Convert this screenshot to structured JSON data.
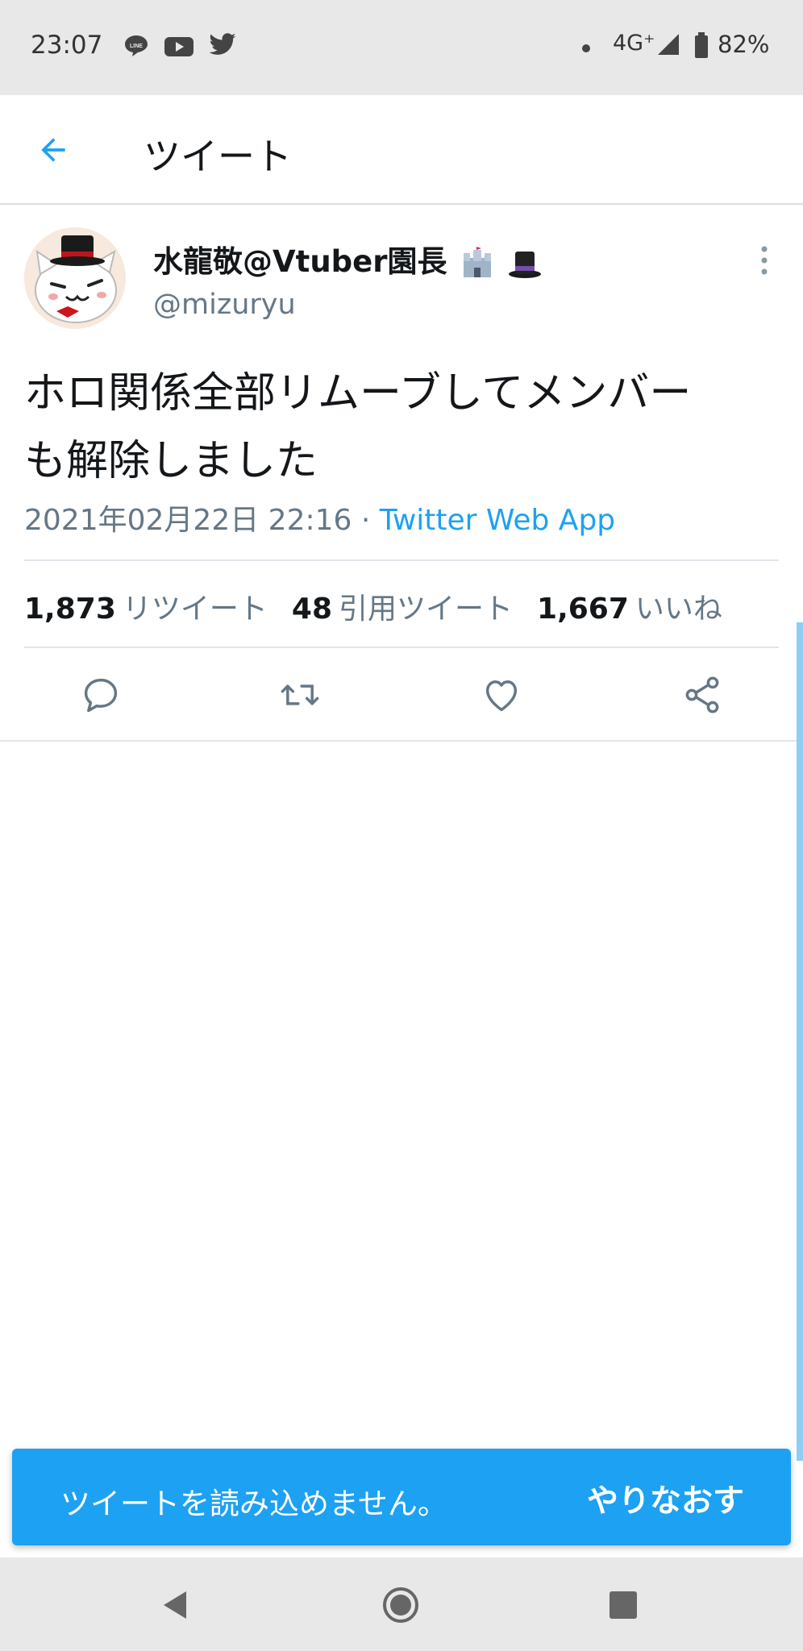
{
  "status_bar": {
    "time": "23:07",
    "notification_icons": [
      "line-icon",
      "youtube-icon",
      "twitter-icon"
    ],
    "network": "4G⁺",
    "battery": "82%"
  },
  "header": {
    "back_icon": "arrow-left-icon",
    "title": "ツイート"
  },
  "tweet": {
    "author_name": "水龍敬@Vtuber園長",
    "author_emoji": [
      "castle-emoji",
      "top-hat-emoji"
    ],
    "handle": "@mizuryu",
    "text_line1": "ホロ関係全部リムーブしてメンバー",
    "text_line2": "も解除しました",
    "timestamp": "2021年02月22日 22:16",
    "separator": " · ",
    "source": "Twitter Web App",
    "stats": {
      "retweets": "1,873",
      "retweets_label": "リツイート",
      "quotes": "48",
      "quotes_label": "引用ツイート",
      "likes": "1,667",
      "likes_label": "いいね"
    },
    "actions": [
      "reply-icon",
      "retweet-icon",
      "like-icon",
      "share-icon"
    ]
  },
  "snackbar": {
    "message": "ツイートを読み込めません。",
    "action": "やりなおす"
  },
  "colors": {
    "accent": "#1da1f2",
    "secondary_text": "#657786",
    "bars": "#e8e8e8"
  }
}
